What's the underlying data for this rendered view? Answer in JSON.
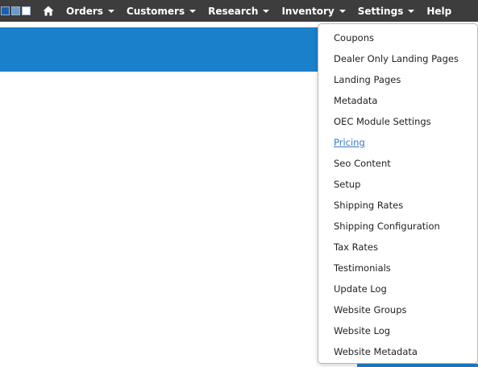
{
  "nav": {
    "items": [
      {
        "label": "Orders",
        "caret": true
      },
      {
        "label": "Customers",
        "caret": true
      },
      {
        "label": "Research",
        "caret": true
      },
      {
        "label": "Inventory",
        "caret": true
      },
      {
        "label": "Settings",
        "caret": true
      },
      {
        "label": "Help",
        "caret": false
      }
    ],
    "home_icon": "home-icon",
    "colors": {
      "bar": "#3d3d3d",
      "text": "#ffffff"
    }
  },
  "dropdown": {
    "items": [
      {
        "label": "Coupons"
      },
      {
        "label": "Dealer Only Landing Pages"
      },
      {
        "label": "Landing Pages"
      },
      {
        "label": "Metadata"
      },
      {
        "label": "OEC Module Settings"
      },
      {
        "label": "Pricing",
        "active": true
      },
      {
        "label": "Seo Content"
      },
      {
        "label": "Setup"
      },
      {
        "label": "Shipping Rates"
      },
      {
        "label": "Shipping Configuration"
      },
      {
        "label": "Tax Rates"
      },
      {
        "label": "Testimonials"
      },
      {
        "label": "Update Log"
      },
      {
        "label": "Website Groups"
      },
      {
        "label": "Website Log"
      },
      {
        "label": "Website Metadata"
      }
    ]
  },
  "colors": {
    "accent": "#1b80cc",
    "link": "#3b78c0"
  }
}
